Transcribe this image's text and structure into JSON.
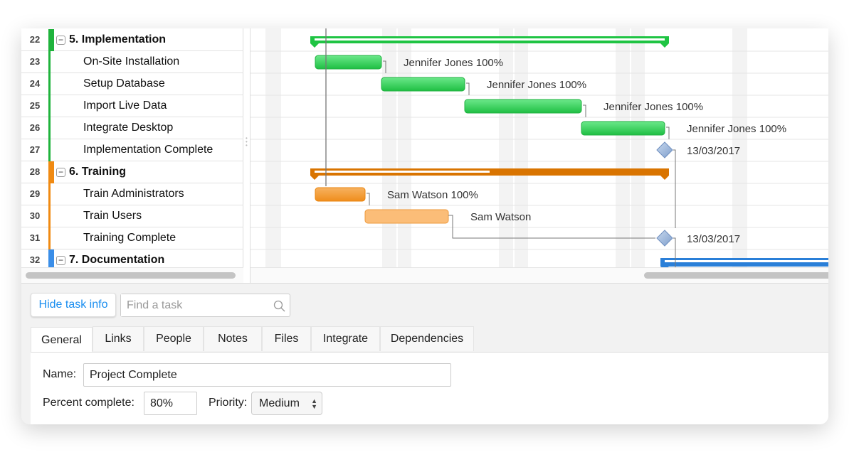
{
  "grid": {
    "rows": [
      {
        "num": "22",
        "name": "5. Implementation",
        "summary": true,
        "color": "#1fb33c"
      },
      {
        "num": "23",
        "name": "On-Site Installation",
        "summary": false,
        "color": "#1fb33c"
      },
      {
        "num": "24",
        "name": "Setup Database",
        "summary": false,
        "color": "#1fb33c"
      },
      {
        "num": "25",
        "name": "Import Live Data",
        "summary": false,
        "color": "#1fb33c"
      },
      {
        "num": "26",
        "name": "Integrate Desktop",
        "summary": false,
        "color": "#1fb33c"
      },
      {
        "num": "27",
        "name": "Implementation Complete",
        "summary": false,
        "color": "#1fb33c"
      },
      {
        "num": "28",
        "name": "6. Training",
        "summary": true,
        "color": "#f08a12"
      },
      {
        "num": "29",
        "name": "Train Administrators",
        "summary": false,
        "color": "#f08a12"
      },
      {
        "num": "30",
        "name": "Train Users",
        "summary": false,
        "color": "#f08a12"
      },
      {
        "num": "31",
        "name": "Training Complete",
        "summary": false,
        "color": "#f08a12"
      },
      {
        "num": "32",
        "name": "7. Documentation",
        "summary": true,
        "color": "#3a8ee8"
      }
    ],
    "collapse_symbol": "−"
  },
  "chart": {
    "labels": [
      {
        "row": 1,
        "text": "Jennifer Jones  100%"
      },
      {
        "row": 2,
        "text": "Jennifer Jones  100%"
      },
      {
        "row": 3,
        "text": "Jennifer Jones  100%"
      },
      {
        "row": 4,
        "text": "Jennifer Jones  100%"
      },
      {
        "row": 5,
        "text": "13/03/2017"
      },
      {
        "row": 7,
        "text": "Sam Watson  100%"
      },
      {
        "row": 8,
        "text": "Sam Watson"
      },
      {
        "row": 9,
        "text": "13/03/2017"
      }
    ],
    "colors": {
      "green": "#2ecc52",
      "orange": "#f39a2e",
      "light_orange": "#fbbd78",
      "summary_orange": "#d97400",
      "blue": "#2a7fd8",
      "milestone": "#9db8db"
    }
  },
  "toolbar": {
    "hide_task_info": "Hide task info",
    "search_placeholder": "Find a task",
    "search_icon": "magnifier-icon"
  },
  "tabs": [
    "General",
    "Links",
    "People",
    "Notes",
    "Files",
    "Integrate",
    "Dependencies"
  ],
  "active_tab": "General",
  "form": {
    "name_label": "Name:",
    "name_value": "Project Complete",
    "percent_label": "Percent complete:",
    "percent_value": "80%",
    "priority_label": "Priority:",
    "priority_value": "Medium"
  }
}
